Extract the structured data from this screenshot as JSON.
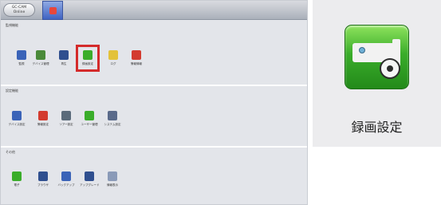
{
  "header": {
    "logo_line1": "GC-CAM",
    "logo_line2": "Online"
  },
  "sections": [
    {
      "label": "監視機能",
      "items": [
        {
          "label": "監視",
          "icon": "eye-icon",
          "color": "#3a63b8"
        },
        {
          "label": "デバイス管理",
          "icon": "device-icon",
          "color": "#4a8a3a"
        },
        {
          "label": "再生",
          "icon": "playback-icon",
          "color": "#2f4f8f"
        },
        {
          "label": "録画設定",
          "icon": "record-settings-icon",
          "color": "#3aad2a"
        },
        {
          "label": "ログ",
          "icon": "log-icon",
          "color": "#e3c23a"
        },
        {
          "label": "警報情報",
          "icon": "alarm-icon",
          "color": "#d33b2f"
        }
      ]
    },
    {
      "label": "設定機能",
      "items": [
        {
          "label": "デバイス設定",
          "icon": "device-settings-icon",
          "color": "#3a63b8"
        },
        {
          "label": "警報設定",
          "icon": "alarm-settings-icon",
          "color": "#d33b2f"
        },
        {
          "label": "ツアー設定",
          "icon": "tour-icon",
          "color": "#5a6a7a"
        },
        {
          "label": "ユーザー管理",
          "icon": "user-icon",
          "color": "#3aad2a"
        },
        {
          "label": "システム設定",
          "icon": "system-icon",
          "color": "#5a6a8a"
        }
      ]
    },
    {
      "label": "その他",
      "items": [
        {
          "label": "電子",
          "icon": "gift-icon",
          "color": "#3aad2a"
        },
        {
          "label": "ブラウザ",
          "icon": "browser-icon",
          "color": "#2f4f8f"
        },
        {
          "label": "バックアップ",
          "icon": "backup-icon",
          "color": "#3a63b8"
        },
        {
          "label": "アップグレード",
          "icon": "upgrade-icon",
          "color": "#2f4f8f"
        },
        {
          "label": "情報表示",
          "icon": "info-icon",
          "color": "#8a9ab8"
        }
      ]
    }
  ],
  "zoom": {
    "label": "録画設定"
  }
}
